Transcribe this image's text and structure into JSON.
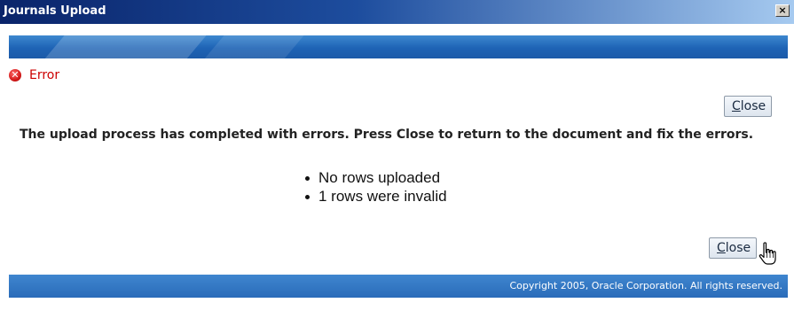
{
  "window": {
    "title": "Journals Upload",
    "close_glyph": "×"
  },
  "error": {
    "icon": "error-circle-x-icon",
    "label": "Error"
  },
  "buttons": {
    "close_top_prefix": "",
    "close_top_underlined": "C",
    "close_top_rest": "lose",
    "close_bottom_underlined": "C",
    "close_bottom_rest": "lose"
  },
  "message": {
    "text": "The upload process has completed with errors. Press Close to return to the document and fix the errors."
  },
  "results": [
    "No rows uploaded",
    "1 rows were invalid"
  ],
  "footer": {
    "copyright": "Copyright 2005, Oracle Corporation. All rights reserved."
  },
  "colors": {
    "error_red": "#cc0000",
    "brand_blue": "#1e63b5"
  }
}
